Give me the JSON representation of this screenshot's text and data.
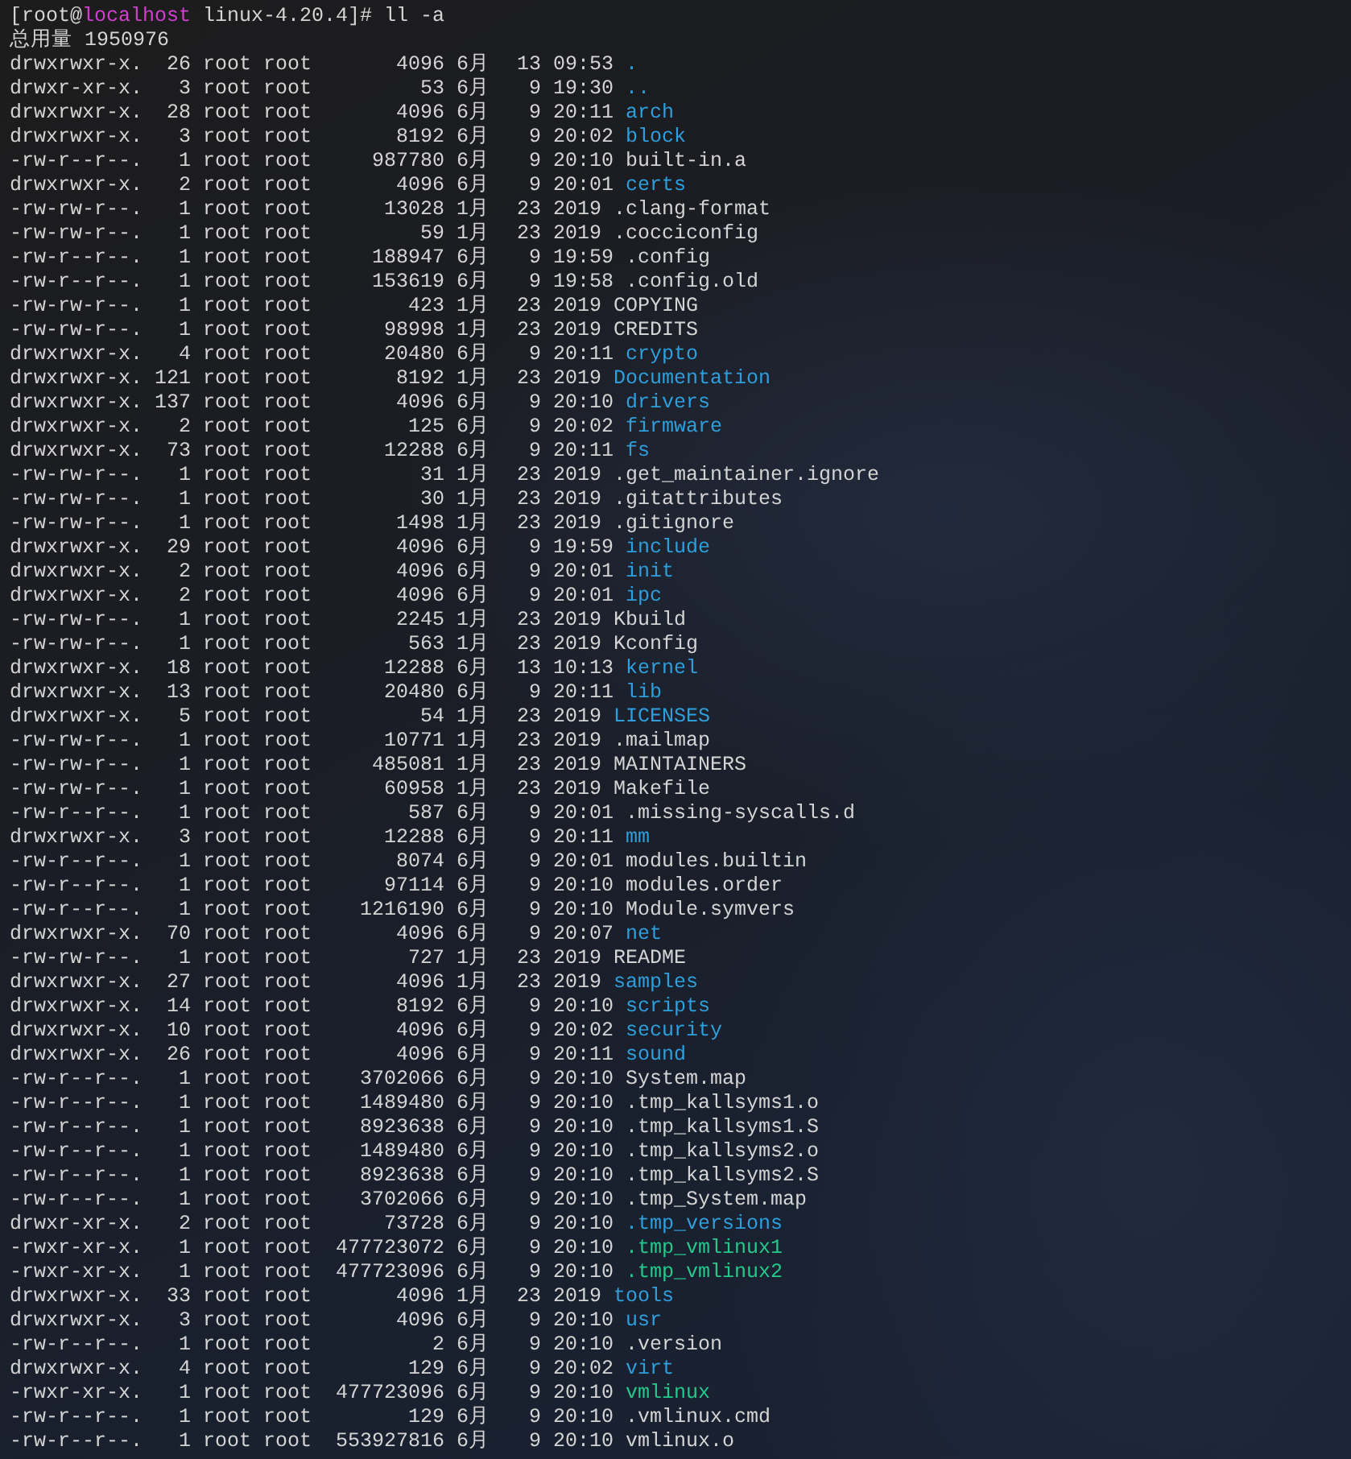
{
  "prompt": {
    "before": "[root@",
    "host": "localhost",
    "after": " linux-4.20.4]# ll -a"
  },
  "total": "总用量 1950976",
  "rows": [
    {
      "perms": "drwxrwxr-x.",
      "links": "26",
      "owner": "root",
      "group": "root",
      "size": "4096",
      "month": "6月",
      "day": "13",
      "time": "09:53",
      "name": ".",
      "kind": "dir"
    },
    {
      "perms": "drwxr-xr-x.",
      "links": "3",
      "owner": "root",
      "group": "root",
      "size": "53",
      "month": "6月",
      "day": "9",
      "time": "19:30",
      "name": "..",
      "kind": "dir"
    },
    {
      "perms": "drwxrwxr-x.",
      "links": "28",
      "owner": "root",
      "group": "root",
      "size": "4096",
      "month": "6月",
      "day": "9",
      "time": "20:11",
      "name": "arch",
      "kind": "dir"
    },
    {
      "perms": "drwxrwxr-x.",
      "links": "3",
      "owner": "root",
      "group": "root",
      "size": "8192",
      "month": "6月",
      "day": "9",
      "time": "20:02",
      "name": "block",
      "kind": "dir"
    },
    {
      "perms": "-rw-r--r--.",
      "links": "1",
      "owner": "root",
      "group": "root",
      "size": "987780",
      "month": "6月",
      "day": "9",
      "time": "20:10",
      "name": "built-in.a",
      "kind": "file"
    },
    {
      "perms": "drwxrwxr-x.",
      "links": "2",
      "owner": "root",
      "group": "root",
      "size": "4096",
      "month": "6月",
      "day": "9",
      "time": "20:01",
      "name": "certs",
      "kind": "dir"
    },
    {
      "perms": "-rw-rw-r--.",
      "links": "1",
      "owner": "root",
      "group": "root",
      "size": "13028",
      "month": "1月",
      "day": "23",
      "time": "2019",
      "name": ".clang-format",
      "kind": "file"
    },
    {
      "perms": "-rw-rw-r--.",
      "links": "1",
      "owner": "root",
      "group": "root",
      "size": "59",
      "month": "1月",
      "day": "23",
      "time": "2019",
      "name": ".cocciconfig",
      "kind": "file"
    },
    {
      "perms": "-rw-r--r--.",
      "links": "1",
      "owner": "root",
      "group": "root",
      "size": "188947",
      "month": "6月",
      "day": "9",
      "time": "19:59",
      "name": ".config",
      "kind": "file"
    },
    {
      "perms": "-rw-r--r--.",
      "links": "1",
      "owner": "root",
      "group": "root",
      "size": "153619",
      "month": "6月",
      "day": "9",
      "time": "19:58",
      "name": ".config.old",
      "kind": "file"
    },
    {
      "perms": "-rw-rw-r--.",
      "links": "1",
      "owner": "root",
      "group": "root",
      "size": "423",
      "month": "1月",
      "day": "23",
      "time": "2019",
      "name": "COPYING",
      "kind": "file"
    },
    {
      "perms": "-rw-rw-r--.",
      "links": "1",
      "owner": "root",
      "group": "root",
      "size": "98998",
      "month": "1月",
      "day": "23",
      "time": "2019",
      "name": "CREDITS",
      "kind": "file"
    },
    {
      "perms": "drwxrwxr-x.",
      "links": "4",
      "owner": "root",
      "group": "root",
      "size": "20480",
      "month": "6月",
      "day": "9",
      "time": "20:11",
      "name": "crypto",
      "kind": "dir"
    },
    {
      "perms": "drwxrwxr-x.",
      "links": "121",
      "owner": "root",
      "group": "root",
      "size": "8192",
      "month": "1月",
      "day": "23",
      "time": "2019",
      "name": "Documentation",
      "kind": "dir"
    },
    {
      "perms": "drwxrwxr-x.",
      "links": "137",
      "owner": "root",
      "group": "root",
      "size": "4096",
      "month": "6月",
      "day": "9",
      "time": "20:10",
      "name": "drivers",
      "kind": "dir"
    },
    {
      "perms": "drwxrwxr-x.",
      "links": "2",
      "owner": "root",
      "group": "root",
      "size": "125",
      "month": "6月",
      "day": "9",
      "time": "20:02",
      "name": "firmware",
      "kind": "dir"
    },
    {
      "perms": "drwxrwxr-x.",
      "links": "73",
      "owner": "root",
      "group": "root",
      "size": "12288",
      "month": "6月",
      "day": "9",
      "time": "20:11",
      "name": "fs",
      "kind": "dir"
    },
    {
      "perms": "-rw-rw-r--.",
      "links": "1",
      "owner": "root",
      "group": "root",
      "size": "31",
      "month": "1月",
      "day": "23",
      "time": "2019",
      "name": ".get_maintainer.ignore",
      "kind": "file"
    },
    {
      "perms": "-rw-rw-r--.",
      "links": "1",
      "owner": "root",
      "group": "root",
      "size": "30",
      "month": "1月",
      "day": "23",
      "time": "2019",
      "name": ".gitattributes",
      "kind": "file"
    },
    {
      "perms": "-rw-rw-r--.",
      "links": "1",
      "owner": "root",
      "group": "root",
      "size": "1498",
      "month": "1月",
      "day": "23",
      "time": "2019",
      "name": ".gitignore",
      "kind": "file"
    },
    {
      "perms": "drwxrwxr-x.",
      "links": "29",
      "owner": "root",
      "group": "root",
      "size": "4096",
      "month": "6月",
      "day": "9",
      "time": "19:59",
      "name": "include",
      "kind": "dir"
    },
    {
      "perms": "drwxrwxr-x.",
      "links": "2",
      "owner": "root",
      "group": "root",
      "size": "4096",
      "month": "6月",
      "day": "9",
      "time": "20:01",
      "name": "init",
      "kind": "dir"
    },
    {
      "perms": "drwxrwxr-x.",
      "links": "2",
      "owner": "root",
      "group": "root",
      "size": "4096",
      "month": "6月",
      "day": "9",
      "time": "20:01",
      "name": "ipc",
      "kind": "dir"
    },
    {
      "perms": "-rw-rw-r--.",
      "links": "1",
      "owner": "root",
      "group": "root",
      "size": "2245",
      "month": "1月",
      "day": "23",
      "time": "2019",
      "name": "Kbuild",
      "kind": "file"
    },
    {
      "perms": "-rw-rw-r--.",
      "links": "1",
      "owner": "root",
      "group": "root",
      "size": "563",
      "month": "1月",
      "day": "23",
      "time": "2019",
      "name": "Kconfig",
      "kind": "file"
    },
    {
      "perms": "drwxrwxr-x.",
      "links": "18",
      "owner": "root",
      "group": "root",
      "size": "12288",
      "month": "6月",
      "day": "13",
      "time": "10:13",
      "name": "kernel",
      "kind": "dir"
    },
    {
      "perms": "drwxrwxr-x.",
      "links": "13",
      "owner": "root",
      "group": "root",
      "size": "20480",
      "month": "6月",
      "day": "9",
      "time": "20:11",
      "name": "lib",
      "kind": "dir"
    },
    {
      "perms": "drwxrwxr-x.",
      "links": "5",
      "owner": "root",
      "group": "root",
      "size": "54",
      "month": "1月",
      "day": "23",
      "time": "2019",
      "name": "LICENSES",
      "kind": "dir"
    },
    {
      "perms": "-rw-rw-r--.",
      "links": "1",
      "owner": "root",
      "group": "root",
      "size": "10771",
      "month": "1月",
      "day": "23",
      "time": "2019",
      "name": ".mailmap",
      "kind": "file"
    },
    {
      "perms": "-rw-rw-r--.",
      "links": "1",
      "owner": "root",
      "group": "root",
      "size": "485081",
      "month": "1月",
      "day": "23",
      "time": "2019",
      "name": "MAINTAINERS",
      "kind": "file"
    },
    {
      "perms": "-rw-rw-r--.",
      "links": "1",
      "owner": "root",
      "group": "root",
      "size": "60958",
      "month": "1月",
      "day": "23",
      "time": "2019",
      "name": "Makefile",
      "kind": "file"
    },
    {
      "perms": "-rw-r--r--.",
      "links": "1",
      "owner": "root",
      "group": "root",
      "size": "587",
      "month": "6月",
      "day": "9",
      "time": "20:01",
      "name": ".missing-syscalls.d",
      "kind": "file"
    },
    {
      "perms": "drwxrwxr-x.",
      "links": "3",
      "owner": "root",
      "group": "root",
      "size": "12288",
      "month": "6月",
      "day": "9",
      "time": "20:11",
      "name": "mm",
      "kind": "dir"
    },
    {
      "perms": "-rw-r--r--.",
      "links": "1",
      "owner": "root",
      "group": "root",
      "size": "8074",
      "month": "6月",
      "day": "9",
      "time": "20:01",
      "name": "modules.builtin",
      "kind": "file"
    },
    {
      "perms": "-rw-r--r--.",
      "links": "1",
      "owner": "root",
      "group": "root",
      "size": "97114",
      "month": "6月",
      "day": "9",
      "time": "20:10",
      "name": "modules.order",
      "kind": "file"
    },
    {
      "perms": "-rw-r--r--.",
      "links": "1",
      "owner": "root",
      "group": "root",
      "size": "1216190",
      "month": "6月",
      "day": "9",
      "time": "20:10",
      "name": "Module.symvers",
      "kind": "file"
    },
    {
      "perms": "drwxrwxr-x.",
      "links": "70",
      "owner": "root",
      "group": "root",
      "size": "4096",
      "month": "6月",
      "day": "9",
      "time": "20:07",
      "name": "net",
      "kind": "dir"
    },
    {
      "perms": "-rw-rw-r--.",
      "links": "1",
      "owner": "root",
      "group": "root",
      "size": "727",
      "month": "1月",
      "day": "23",
      "time": "2019",
      "name": "README",
      "kind": "file"
    },
    {
      "perms": "drwxrwxr-x.",
      "links": "27",
      "owner": "root",
      "group": "root",
      "size": "4096",
      "month": "1月",
      "day": "23",
      "time": "2019",
      "name": "samples",
      "kind": "dir"
    },
    {
      "perms": "drwxrwxr-x.",
      "links": "14",
      "owner": "root",
      "group": "root",
      "size": "8192",
      "month": "6月",
      "day": "9",
      "time": "20:10",
      "name": "scripts",
      "kind": "dir"
    },
    {
      "perms": "drwxrwxr-x.",
      "links": "10",
      "owner": "root",
      "group": "root",
      "size": "4096",
      "month": "6月",
      "day": "9",
      "time": "20:02",
      "name": "security",
      "kind": "dir"
    },
    {
      "perms": "drwxrwxr-x.",
      "links": "26",
      "owner": "root",
      "group": "root",
      "size": "4096",
      "month": "6月",
      "day": "9",
      "time": "20:11",
      "name": "sound",
      "kind": "dir"
    },
    {
      "perms": "-rw-r--r--.",
      "links": "1",
      "owner": "root",
      "group": "root",
      "size": "3702066",
      "month": "6月",
      "day": "9",
      "time": "20:10",
      "name": "System.map",
      "kind": "file"
    },
    {
      "perms": "-rw-r--r--.",
      "links": "1",
      "owner": "root",
      "group": "root",
      "size": "1489480",
      "month": "6月",
      "day": "9",
      "time": "20:10",
      "name": ".tmp_kallsyms1.o",
      "kind": "file"
    },
    {
      "perms": "-rw-r--r--.",
      "links": "1",
      "owner": "root",
      "group": "root",
      "size": "8923638",
      "month": "6月",
      "day": "9",
      "time": "20:10",
      "name": ".tmp_kallsyms1.S",
      "kind": "file"
    },
    {
      "perms": "-rw-r--r--.",
      "links": "1",
      "owner": "root",
      "group": "root",
      "size": "1489480",
      "month": "6月",
      "day": "9",
      "time": "20:10",
      "name": ".tmp_kallsyms2.o",
      "kind": "file"
    },
    {
      "perms": "-rw-r--r--.",
      "links": "1",
      "owner": "root",
      "group": "root",
      "size": "8923638",
      "month": "6月",
      "day": "9",
      "time": "20:10",
      "name": ".tmp_kallsyms2.S",
      "kind": "file"
    },
    {
      "perms": "-rw-r--r--.",
      "links": "1",
      "owner": "root",
      "group": "root",
      "size": "3702066",
      "month": "6月",
      "day": "9",
      "time": "20:10",
      "name": ".tmp_System.map",
      "kind": "file"
    },
    {
      "perms": "drwxr-xr-x.",
      "links": "2",
      "owner": "root",
      "group": "root",
      "size": "73728",
      "month": "6月",
      "day": "9",
      "time": "20:10",
      "name": ".tmp_versions",
      "kind": "dir"
    },
    {
      "perms": "-rwxr-xr-x.",
      "links": "1",
      "owner": "root",
      "group": "root",
      "size": "477723072",
      "month": "6月",
      "day": "9",
      "time": "20:10",
      "name": ".tmp_vmlinux1",
      "kind": "exec"
    },
    {
      "perms": "-rwxr-xr-x.",
      "links": "1",
      "owner": "root",
      "group": "root",
      "size": "477723096",
      "month": "6月",
      "day": "9",
      "time": "20:10",
      "name": ".tmp_vmlinux2",
      "kind": "exec"
    },
    {
      "perms": "drwxrwxr-x.",
      "links": "33",
      "owner": "root",
      "group": "root",
      "size": "4096",
      "month": "1月",
      "day": "23",
      "time": "2019",
      "name": "tools",
      "kind": "dir"
    },
    {
      "perms": "drwxrwxr-x.",
      "links": "3",
      "owner": "root",
      "group": "root",
      "size": "4096",
      "month": "6月",
      "day": "9",
      "time": "20:10",
      "name": "usr",
      "kind": "dir"
    },
    {
      "perms": "-rw-r--r--.",
      "links": "1",
      "owner": "root",
      "group": "root",
      "size": "2",
      "month": "6月",
      "day": "9",
      "time": "20:10",
      "name": ".version",
      "kind": "file"
    },
    {
      "perms": "drwxrwxr-x.",
      "links": "4",
      "owner": "root",
      "group": "root",
      "size": "129",
      "month": "6月",
      "day": "9",
      "time": "20:02",
      "name": "virt",
      "kind": "dir"
    },
    {
      "perms": "-rwxr-xr-x.",
      "links": "1",
      "owner": "root",
      "group": "root",
      "size": "477723096",
      "month": "6月",
      "day": "9",
      "time": "20:10",
      "name": "vmlinux",
      "kind": "exec"
    },
    {
      "perms": "-rw-r--r--.",
      "links": "1",
      "owner": "root",
      "group": "root",
      "size": "129",
      "month": "6月",
      "day": "9",
      "time": "20:10",
      "name": ".vmlinux.cmd",
      "kind": "file"
    },
    {
      "perms": "-rw-r--r--.",
      "links": "1",
      "owner": "root",
      "group": "root",
      "size": "553927816",
      "month": "6月",
      "day": "9",
      "time": "20:10",
      "name": "vmlinux.o",
      "kind": "file"
    }
  ]
}
